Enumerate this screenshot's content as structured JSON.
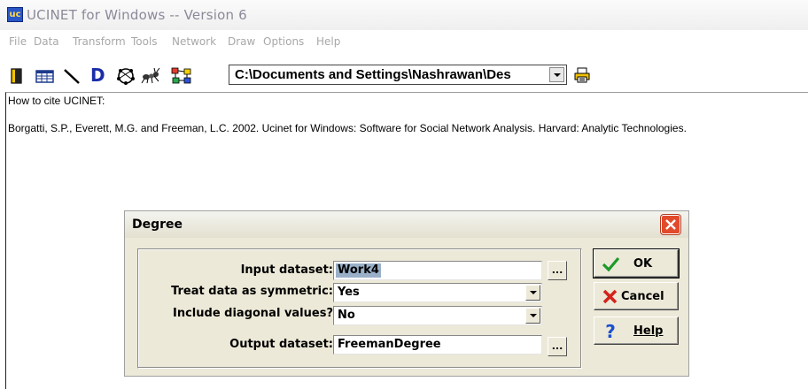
{
  "window": {
    "title": "UCINET for Windows -- Version 6",
    "icon_text": "uc"
  },
  "menu": [
    "File",
    "Data",
    "Transform",
    "Tools",
    "Network",
    "Draw",
    "Options",
    "Help"
  ],
  "toolbar": {
    "icons": [
      "open-icon",
      "spreadsheet-icon",
      "line-draw-icon",
      "d-icon",
      "netdraw-icon",
      "ant-icon",
      "graph-icon",
      "printer-icon"
    ],
    "d_label": "D",
    "path": "C:\\Documents and Settings\\Nashrawan\\Des"
  },
  "content": {
    "cite_heading": "How to cite UCINET:",
    "cite_text": "Borgatti, S.P., Everett, M.G. and Freeman, L.C. 2002. Ucinet for Windows: Software for Social Network Analysis. Harvard: Analytic Technologies."
  },
  "dialog": {
    "title": "Degree",
    "fields": [
      {
        "label": "Input dataset:",
        "value": "Work4",
        "control": "browse"
      },
      {
        "label": "Treat data as symmetric:",
        "value": "Yes",
        "control": "dropdown"
      },
      {
        "label": "Include diagonal values?",
        "value": "No",
        "control": "dropdown"
      },
      {
        "label": "Output dataset:",
        "value": "FreemanDegree",
        "control": "browse"
      }
    ],
    "browse_label": "...",
    "buttons": {
      "ok": "OK",
      "cancel": "Cancel",
      "help": "Help"
    }
  },
  "colors": {
    "dialog_bg": "#ece9d8",
    "close_button": "#e24a2c",
    "selection": "#9ab0c8"
  }
}
